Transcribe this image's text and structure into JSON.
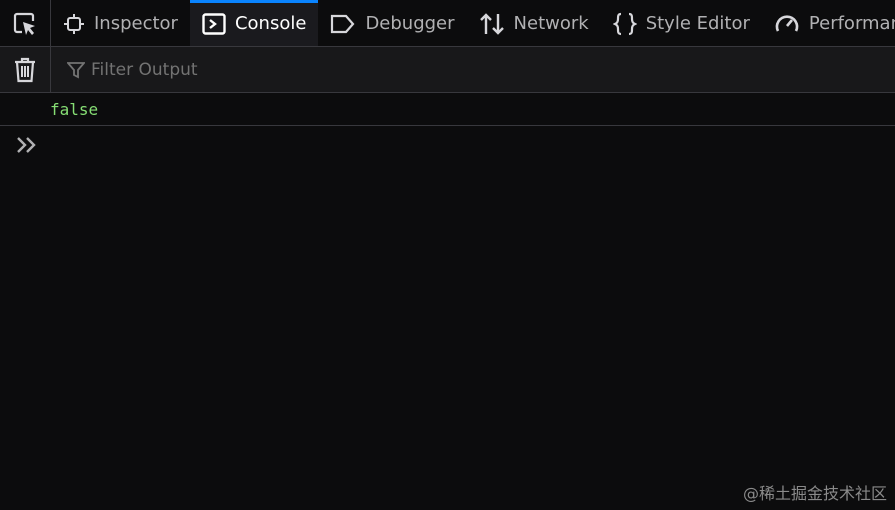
{
  "toolbar": {
    "tabs": [
      {
        "label": "Inspector",
        "icon": "inspector-icon"
      },
      {
        "label": "Console",
        "icon": "console-icon",
        "selected": true
      },
      {
        "label": "Debugger",
        "icon": "debugger-icon"
      },
      {
        "label": "Network",
        "icon": "network-icon"
      },
      {
        "label": "Style Editor",
        "icon": "style-editor-icon"
      },
      {
        "label": "Performance",
        "icon": "performance-icon"
      }
    ]
  },
  "filter": {
    "placeholder": "Filter Output"
  },
  "console": {
    "messages": [
      {
        "text": "false",
        "color": "#86de74"
      }
    ]
  },
  "watermark": "@稀土掘金技术社区",
  "colors": {
    "accent": "#0a84ff",
    "background": "#0c0c0d",
    "text": "#d7d7db"
  }
}
